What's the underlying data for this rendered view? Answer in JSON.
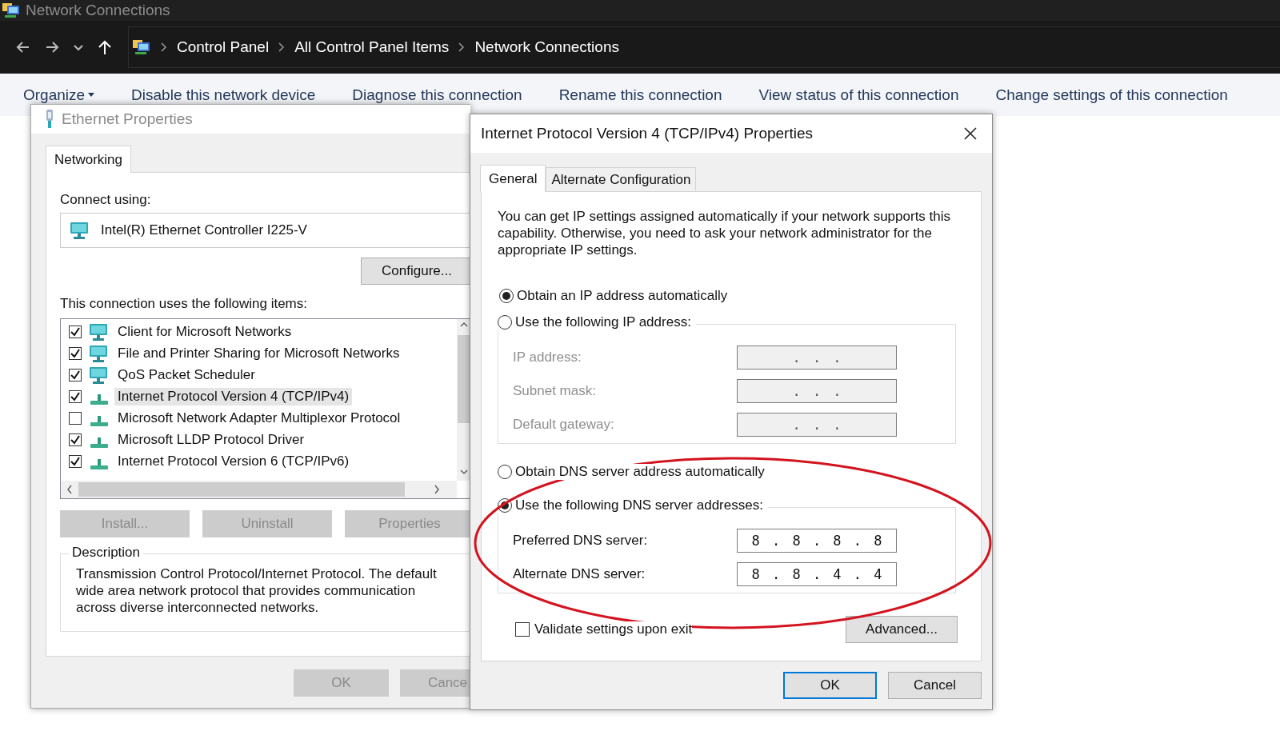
{
  "window": {
    "title": "Network Connections"
  },
  "address_bar": {
    "breadcrumbs": [
      "Control Panel",
      "All Control Panel Items",
      "Network Connections"
    ]
  },
  "command_bar": {
    "items": [
      {
        "label": "Organize",
        "dropdown": true
      },
      {
        "label": "Disable this network device",
        "dropdown": false
      },
      {
        "label": "Diagnose this connection",
        "dropdown": false
      },
      {
        "label": "Rename this connection",
        "dropdown": false
      },
      {
        "label": "View status of this connection",
        "dropdown": false
      },
      {
        "label": "Change settings of this connection",
        "dropdown": false
      }
    ]
  },
  "ethernet_dialog": {
    "title": "Ethernet Properties",
    "tabs": [
      {
        "label": "Networking",
        "selected": true
      }
    ],
    "connect_using_label": "Connect using:",
    "adapter": "Intel(R) Ethernet Controller I225-V",
    "configure_button": "Configure...",
    "items_label": "This connection uses the following items:",
    "items": [
      {
        "label": "Client for Microsoft Networks",
        "checked": true,
        "selected": false,
        "kind": "monitor"
      },
      {
        "label": "File and Printer Sharing for Microsoft Networks",
        "checked": true,
        "selected": false,
        "kind": "monitor"
      },
      {
        "label": "QoS Packet Scheduler",
        "checked": true,
        "selected": false,
        "kind": "monitor"
      },
      {
        "label": "Internet Protocol Version 4 (TCP/IPv4)",
        "checked": true,
        "selected": true,
        "kind": "protocol"
      },
      {
        "label": "Microsoft Network Adapter Multiplexor Protocol",
        "checked": false,
        "selected": false,
        "kind": "protocol"
      },
      {
        "label": "Microsoft LLDP Protocol Driver",
        "checked": true,
        "selected": false,
        "kind": "protocol"
      },
      {
        "label": "Internet Protocol Version 6 (TCP/IPv6)",
        "checked": true,
        "selected": false,
        "kind": "protocol"
      }
    ],
    "buttons": [
      {
        "label": "Install...",
        "disabled": true
      },
      {
        "label": "Uninstall",
        "disabled": true
      },
      {
        "label": "Properties",
        "disabled": true
      }
    ],
    "description": {
      "title": "Description",
      "text": "Transmission Control Protocol/Internet Protocol. The default wide area network protocol that provides communication across diverse interconnected networks."
    },
    "footer_buttons": [
      {
        "label": "OK",
        "disabled": true
      },
      {
        "label": "Cance",
        "disabled": true
      }
    ]
  },
  "ipv4_dialog": {
    "title": "Internet Protocol Version 4 (TCP/IPv4) Properties",
    "tabs": [
      {
        "label": "General",
        "selected": true
      },
      {
        "label": "Alternate Configuration",
        "selected": false
      }
    ],
    "intro": "You can get IP settings assigned automatically if your network supports this capability. Otherwise, you need to ask your network administrator for the appropriate IP settings.",
    "ip_section": {
      "options": [
        {
          "label": "Obtain an IP address automatically",
          "selected": true
        },
        {
          "label": "Use the following IP address:",
          "selected": false
        }
      ],
      "fields": [
        {
          "label": "IP address:",
          "value": ". . .",
          "disabled": true
        },
        {
          "label": "Subnet mask:",
          "value": ". . .",
          "disabled": true
        },
        {
          "label": "Default gateway:",
          "value": ". . .",
          "disabled": true
        }
      ]
    },
    "dns_section": {
      "options": [
        {
          "label": "Obtain DNS server address automatically",
          "selected": false
        },
        {
          "label": "Use the following DNS server addresses:",
          "selected": true
        }
      ],
      "fields": [
        {
          "label": "Preferred DNS server:",
          "value": "8 . 8 . 8 . 8",
          "disabled": false
        },
        {
          "label": "Alternate DNS server:",
          "value": "8 . 8 . 4 . 4",
          "disabled": false
        }
      ]
    },
    "validate": {
      "label": "Validate settings upon exit",
      "checked": false
    },
    "advanced_button": "Advanced...",
    "buttons": [
      {
        "label": "OK",
        "default": true
      },
      {
        "label": "Cancel",
        "default": false
      }
    ]
  },
  "annotations": [
    {
      "kind": "ellipse"
    }
  ]
}
